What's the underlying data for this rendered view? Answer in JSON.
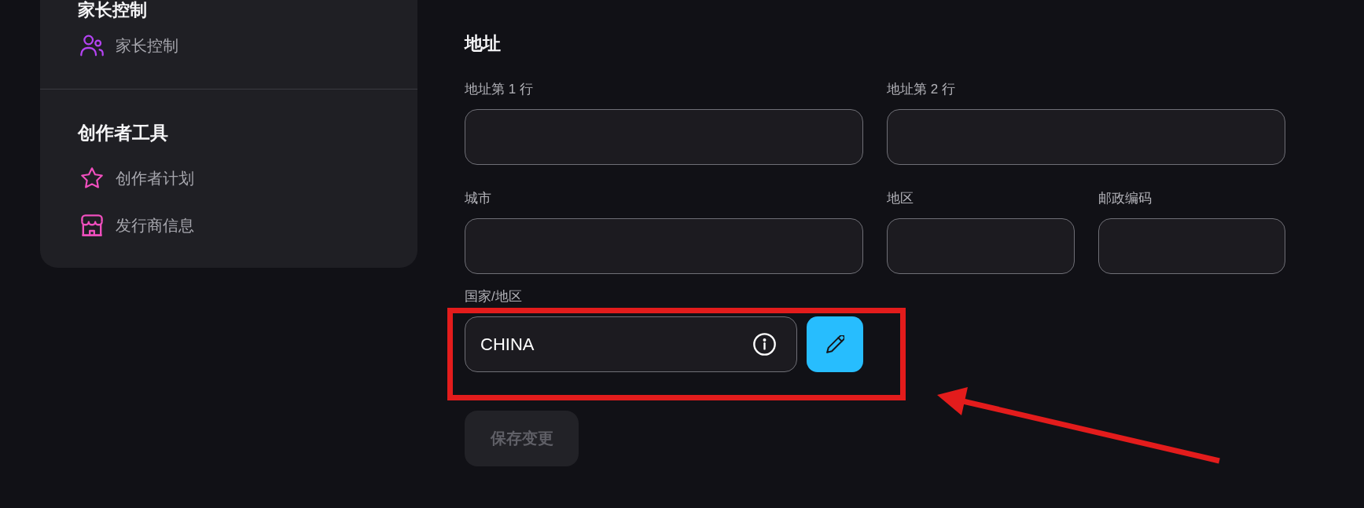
{
  "sidebar": {
    "sections": [
      {
        "heading": "家长控制",
        "items": [
          {
            "label": "家长控制",
            "selected": false
          }
        ]
      },
      {
        "heading": "创作者工具",
        "items": [
          {
            "label": "创作者计划",
            "selected": false
          },
          {
            "label": "发行商信息",
            "selected": false
          }
        ]
      }
    ]
  },
  "address_form": {
    "title": "地址",
    "fields": [
      {
        "label": "地址第 1 行"
      },
      {
        "label": "地址第 2 行"
      },
      {
        "label": "城市"
      },
      {
        "label": "地区"
      },
      {
        "label": "邮政编码"
      }
    ],
    "country": {
      "label": "国家/地区",
      "value": "CHINA"
    },
    "save_button": {
      "label": "保存变更",
      "disabled": true
    }
  },
  "annotations": [
    {
      "kind": "highlight-box"
    },
    {
      "kind": "arrow"
    }
  ]
}
